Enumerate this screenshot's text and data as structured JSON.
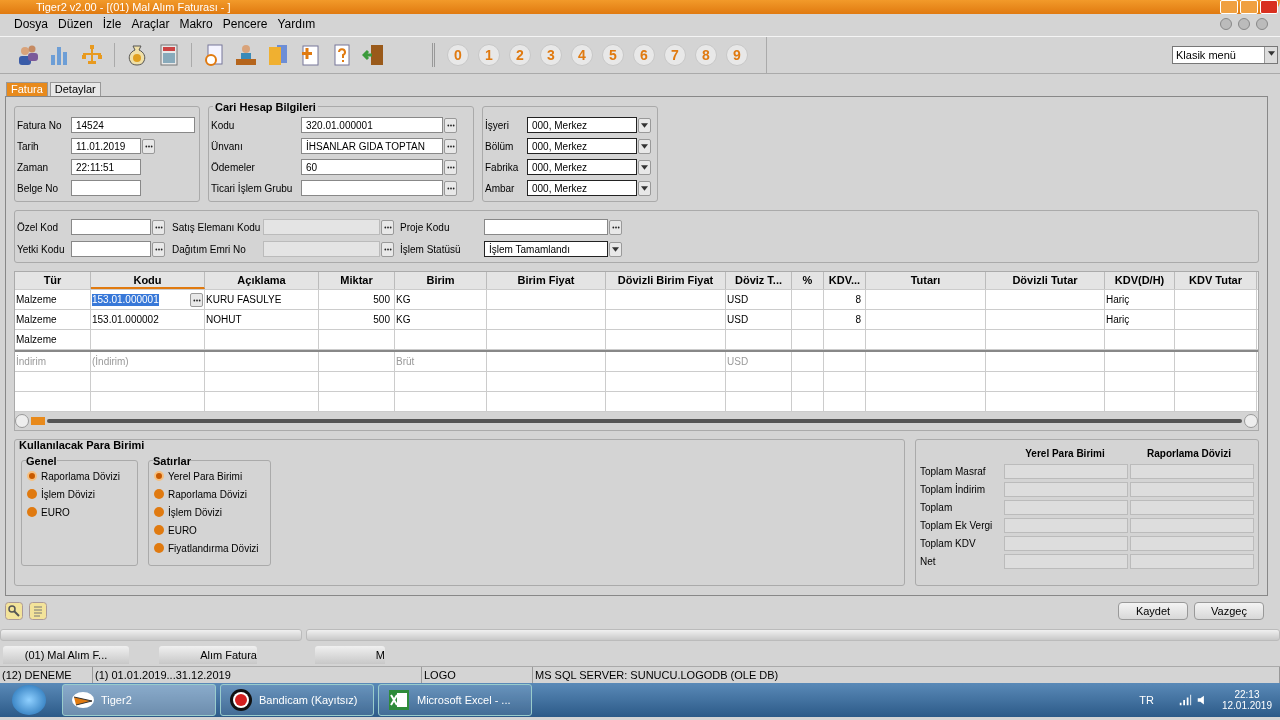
{
  "window": {
    "title": "Tiger2 v2.00 - [(01) Mal Alım Faturası - ]"
  },
  "menu": [
    "Dosya",
    "Düzen",
    "İzle",
    "Araçlar",
    "Makro",
    "Pencere",
    "Yardım"
  ],
  "number_buttons": [
    "0",
    "1",
    "2",
    "3",
    "4",
    "5",
    "6",
    "7",
    "8",
    "9"
  ],
  "menu_style": {
    "value": "Klasik menü"
  },
  "tabs": [
    {
      "label": "Fatura",
      "selected": true
    },
    {
      "label": "Detaylar",
      "selected": false
    }
  ],
  "invoice_fields": [
    {
      "label": "Fatura No",
      "value": "14524",
      "kind": "text"
    },
    {
      "label": "Tarih",
      "value": "11.01.2019",
      "kind": "lookup"
    },
    {
      "label": "Zaman",
      "value": "22:11:51",
      "kind": "text"
    },
    {
      "label": "Belge No",
      "kind": "text"
    }
  ],
  "account": {
    "title": "Cari Hesap Bilgileri",
    "fields": [
      {
        "label": "Kodu",
        "value": "320.01.000001",
        "kind": "lookup"
      },
      {
        "label": "Ünvanı",
        "value": "İHSANLAR GIDA TOPTAN",
        "kind": "lookup"
      },
      {
        "label": "Ödemeler",
        "value": "60",
        "kind": "lookup"
      },
      {
        "label": "Ticari İşlem Grubu",
        "kind": "lookup"
      }
    ]
  },
  "location_fields": [
    {
      "label": "İşyeri",
      "value": "000, Merkez",
      "kind": "dropdown"
    },
    {
      "label": "Bölüm",
      "value": "000, Merkez",
      "kind": "dropdown"
    },
    {
      "label": "Fabrika",
      "value": "000, Merkez",
      "kind": "dropdown"
    },
    {
      "label": "Ambar",
      "value": "000, Merkez",
      "kind": "dropdown"
    }
  ],
  "code_fields": [
    {
      "label": "Özel Kod",
      "kind": "lookup",
      "disabled": false
    },
    {
      "label": "Satış Elemanı Kodu",
      "kind": "lookup",
      "disabled": true
    },
    {
      "label": "Proje Kodu",
      "kind": "lookup",
      "disabled": false
    },
    {
      "label": "Yetki Kodu",
      "kind": "lookup",
      "disabled": false
    },
    {
      "label": "Dağıtım Emri No",
      "kind": "lookup",
      "disabled": true
    },
    {
      "label": "İşlem Statüsü",
      "value": "İşlem Tamamlandı",
      "kind": "dropdown",
      "disabled": false
    }
  ],
  "table": {
    "columns": [
      "Tür",
      "Kodu",
      "Açıklama",
      "Miktar",
      "Birim",
      "Birim Fiyat",
      "Dövizli Birim Fiyat",
      "Döviz T...",
      "%",
      "KDV...",
      "Tutarı",
      "Dövizli Tutar",
      "KDV(D/H)",
      "KDV Tutar"
    ],
    "rows": [
      {
        "kind": "item",
        "selected": true,
        "tur": "Malzeme",
        "kodu": "153.01.000001",
        "aciklama": "KURU FASULYE",
        "miktar": "500",
        "birim": "KG",
        "doviz": "USD",
        "kdv": "8",
        "kdv_dh": "Hariç"
      },
      {
        "kind": "item",
        "selected": false,
        "tur": "Malzeme",
        "kodu": "153.01.000002",
        "aciklama": "NOHUT",
        "miktar": "500",
        "birim": "KG",
        "doviz": "USD",
        "kdv": "8",
        "kdv_dh": "Hariç"
      },
      {
        "kind": "item",
        "selected": false,
        "tur": "Malzeme"
      },
      {
        "kind": "discount",
        "selected": false,
        "tur": "İndirim",
        "kodu": "(İndirim)",
        "birim": "Brüt",
        "doviz": "USD"
      }
    ]
  },
  "currency": {
    "title": "Kullanılacak Para Birimi",
    "groups": [
      {
        "title": "Genel",
        "options": [
          {
            "label": "Raporlama Dövizi",
            "selected": true
          },
          {
            "label": "İşlem Dövizi",
            "selected": false
          },
          {
            "label": "EURO",
            "selected": false
          }
        ]
      },
      {
        "title": "Satırlar",
        "options": [
          {
            "label": "Yerel Para Birimi",
            "selected": true
          },
          {
            "label": "Raporlama Dövizi",
            "selected": false
          },
          {
            "label": "İşlem Dövizi",
            "selected": false
          },
          {
            "label": "EURO",
            "selected": false
          },
          {
            "label": "Fiyatlandırma Dövizi",
            "selected": false
          }
        ]
      }
    ]
  },
  "totals": {
    "columns": [
      "Yerel Para Birimi",
      "Raporlama Dövizi"
    ],
    "rows": [
      "Toplam Masraf",
      "Toplam İndirim",
      "Toplam",
      "Toplam Ek Vergi",
      "Toplam KDV",
      "Net"
    ]
  },
  "buttons": [
    "Kaydet",
    "Vazgeç"
  ],
  "window_tabs": [
    "(01) Mal Alım F...",
    "Alım Fatura",
    "M"
  ],
  "status_bar": [
    "(12) DENEME",
    "(1) 01.01.2019...31.12.2019",
    "LOGO",
    "MS SQL SERVER: SUNUCU.LOGODB (OLE DB)"
  ],
  "taskbar": {
    "apps": [
      "Tiger2",
      "Bandicam (Kayıtsız)",
      "Microsoft Excel - ..."
    ],
    "language": "TR",
    "time": "22:13",
    "date": "12.01.2019"
  }
}
